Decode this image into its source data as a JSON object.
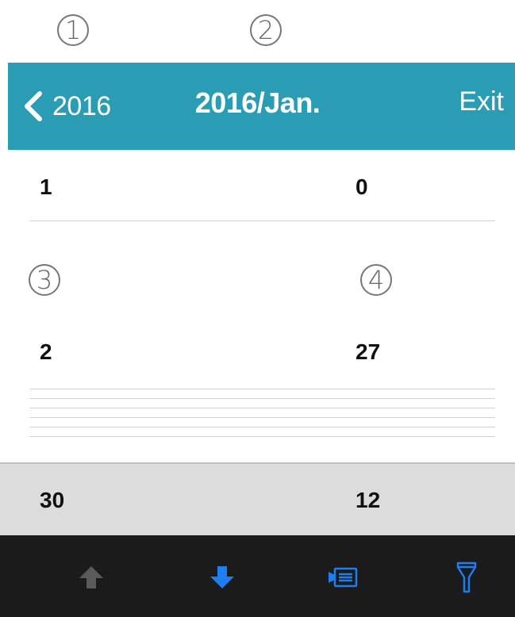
{
  "callouts": [
    "1",
    "2",
    "3",
    "4"
  ],
  "header": {
    "back_label": "2016",
    "title": "2016/Jan.",
    "exit_label": "Exit",
    "background_color": "#2a9db5"
  },
  "rows": [
    {
      "label": "1",
      "value": "0"
    },
    {
      "label": "2",
      "value": "27"
    }
  ],
  "selected_row": {
    "label": "30",
    "value": "12"
  },
  "toolbar": {
    "items": [
      {
        "icon": "arrow-up-icon",
        "state": "disabled",
        "color": "#5a5a5a"
      },
      {
        "icon": "arrow-down-icon",
        "state": "active",
        "color": "#1e7ef0"
      },
      {
        "icon": "list-icon",
        "state": "active",
        "color": "#1e7ef0"
      },
      {
        "icon": "filter-icon",
        "state": "active",
        "color": "#1e7ef0"
      }
    ]
  }
}
